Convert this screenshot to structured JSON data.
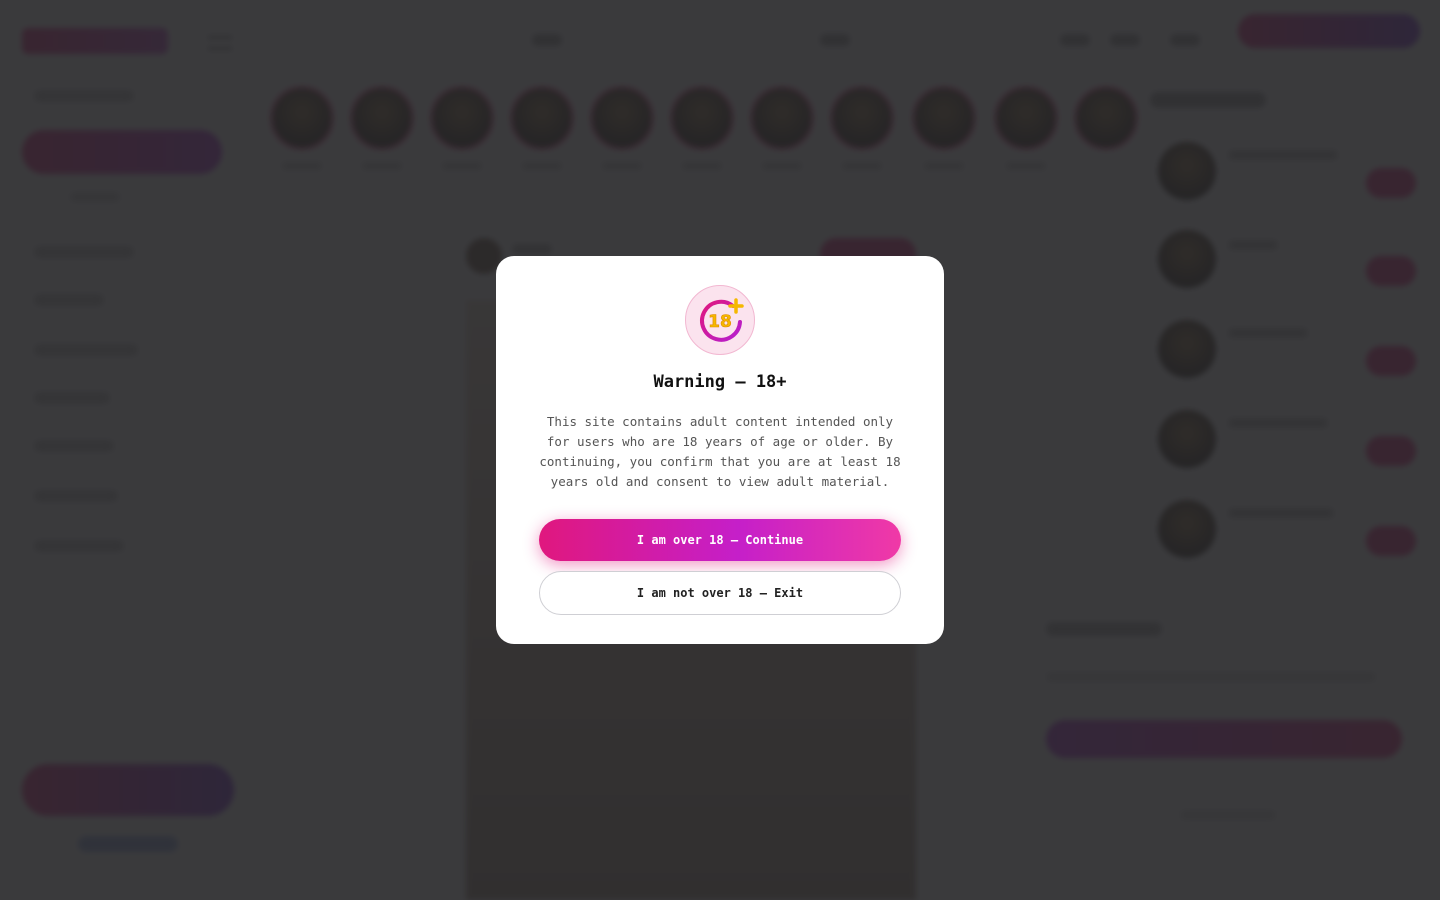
{
  "modal": {
    "badge_text": "18",
    "title": "Warning — 18+",
    "body": "This site contains adult content intended only for users who are 18 years of age or older. By continuing, you confirm that you are at least 18 years old and consent to view adult material.",
    "continue_label": "I am over 18 — Continue",
    "exit_label": "I am not over 18 — Exit"
  },
  "colors": {
    "accent_pink": "#e0187e",
    "accent_purple": "#c51fc9",
    "badge_gold": "#f5b800",
    "overlay": "#262628"
  },
  "icons": {
    "badge": "adult-18-plus-icon"
  }
}
